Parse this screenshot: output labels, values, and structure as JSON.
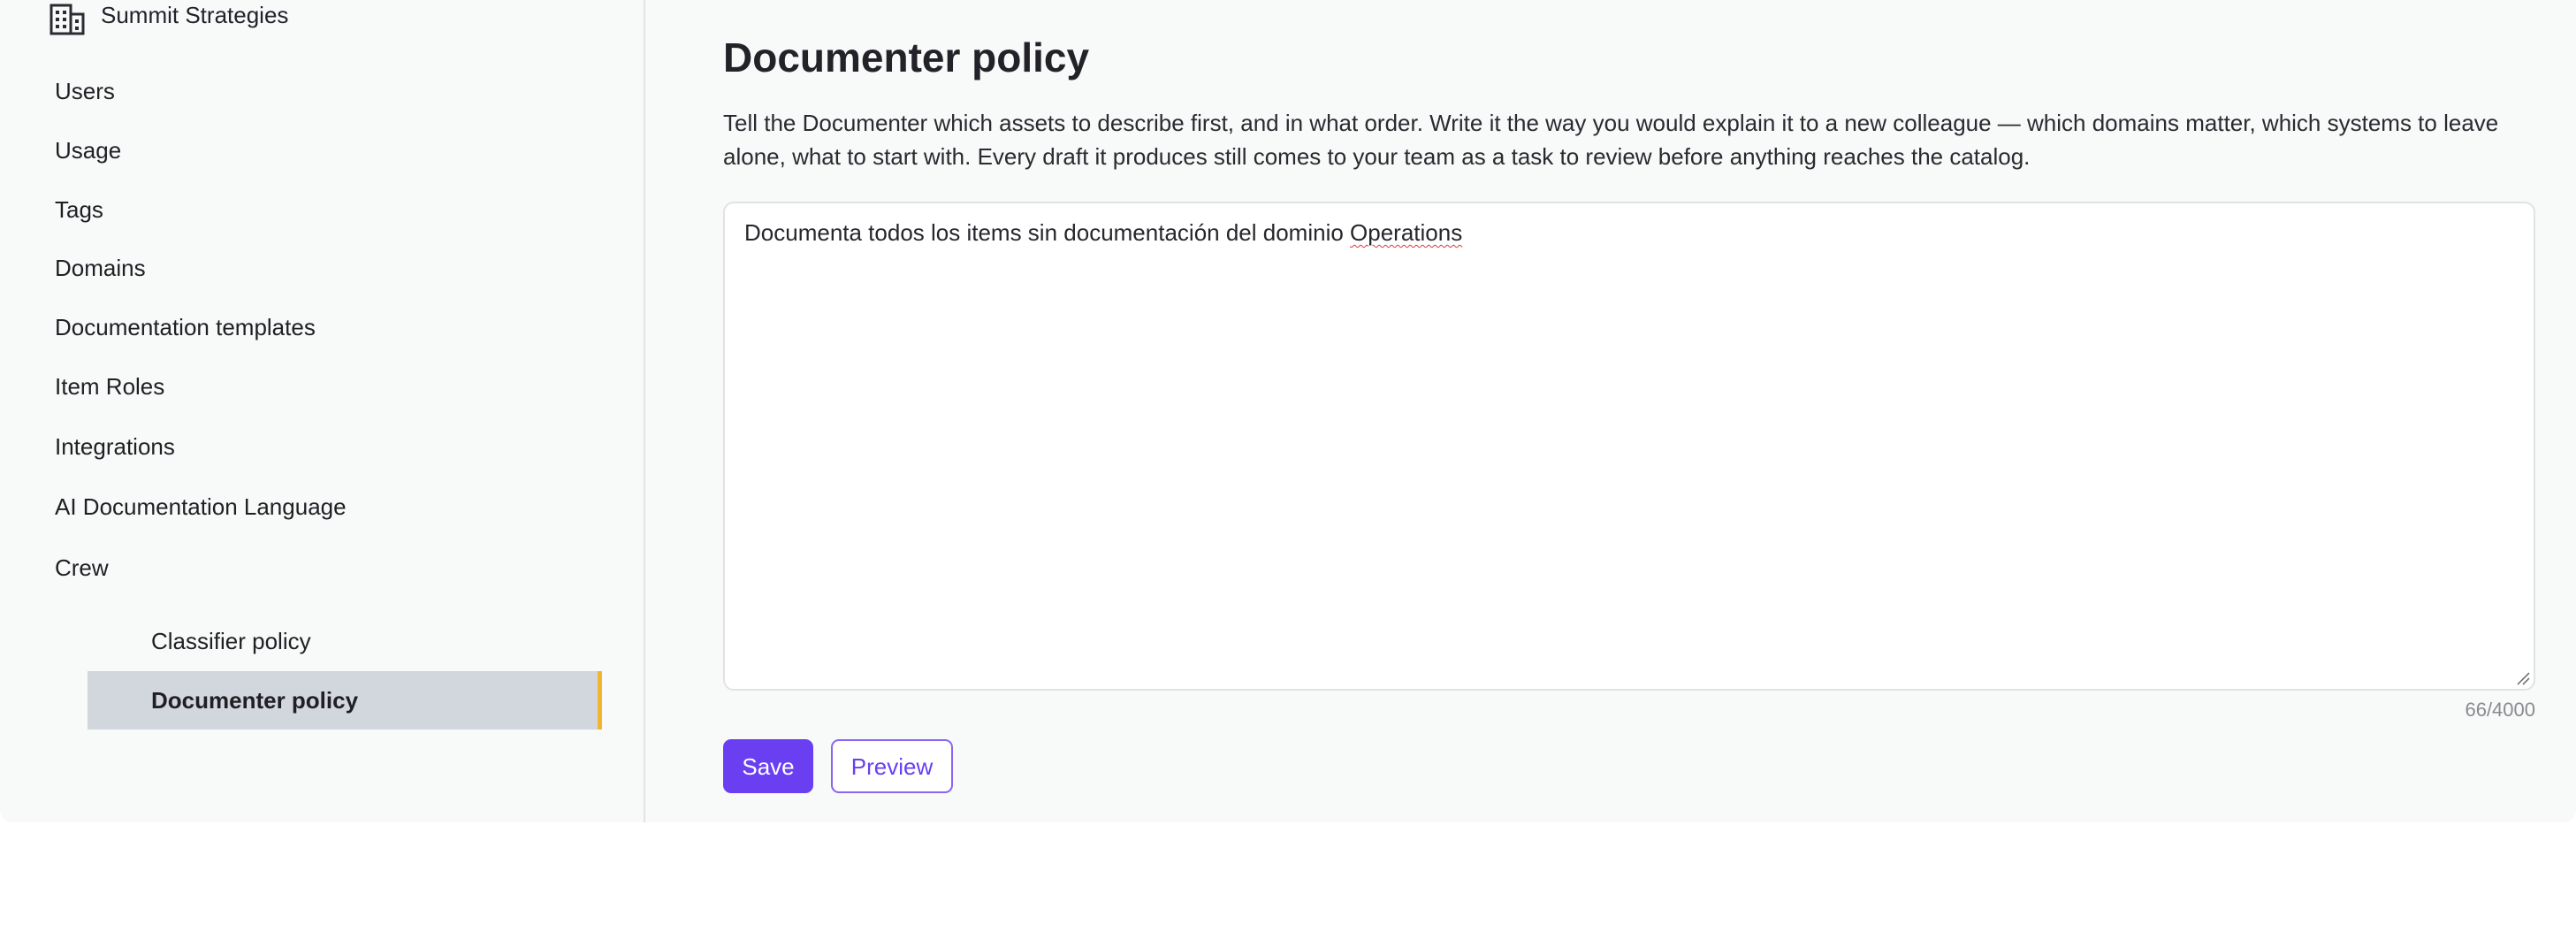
{
  "org": {
    "name": "Summit Strategies",
    "icon": "building-icon"
  },
  "nav": {
    "items": [
      {
        "label": "Users"
      },
      {
        "label": "Usage"
      },
      {
        "label": "Tags"
      },
      {
        "label": "Domains"
      },
      {
        "label": "Documentation templates"
      },
      {
        "label": "Item Roles"
      },
      {
        "label": "Integrations"
      },
      {
        "label": "AI Documentation Language"
      },
      {
        "label": "Crew"
      }
    ],
    "crew_sub": [
      {
        "label": "Classifier policy",
        "active": false
      },
      {
        "label": "Documenter policy",
        "active": true
      }
    ]
  },
  "page": {
    "title": "Documenter policy",
    "description": "Tell the Documenter which assets to describe first, and in what order. Write it the way you would explain it to a new colleague — which domains matter, which systems to leave alone, what to start with. Every draft it produces still comes to your team as a task to review before anything reaches the catalog.",
    "policy_text_before": "Documenta todos los items sin documentación del dominio ",
    "policy_text_flagged": "Operations",
    "char_count": "66/4000",
    "save_label": "Save",
    "preview_label": "Preview"
  },
  "colors": {
    "accent": "#6a3ff2",
    "active_marker": "#f2b530",
    "active_bg": "#d2d6dd"
  }
}
